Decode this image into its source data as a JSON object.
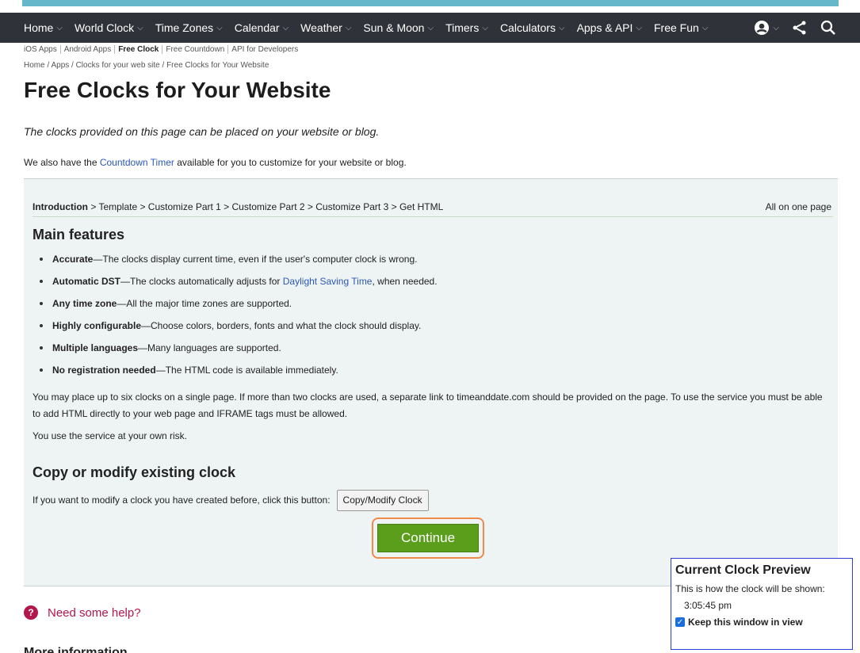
{
  "nav": {
    "items": [
      "Home",
      "World Clock",
      "Time Zones",
      "Calendar",
      "Weather",
      "Sun & Moon",
      "Timers",
      "Calculators",
      "Apps & API",
      "Free Fun"
    ]
  },
  "subnav": {
    "items": [
      "iOS Apps",
      "Android Apps",
      "Free Clock",
      "Free Countdown",
      "API for Developers"
    ],
    "active": "Free Clock"
  },
  "breadcrumb": "Home /  Apps /  Clocks for your web site /  Free Clocks for Your Website",
  "page": {
    "title": "Free Clocks for Your Website",
    "intro": "The clocks provided on this page can be placed on your website or blog.",
    "also_before": "We also have the ",
    "also_link": "Countdown Timer",
    "also_after": " available for you to customize for your website or blog."
  },
  "steps": {
    "current": "Introduction",
    "rest": " > Template > Customize Part 1 > Customize Part 2 > Customize Part 3 > Get HTML",
    "all_on_one": "All on one page"
  },
  "features": {
    "heading": "Main features",
    "items": [
      {
        "title": "Accurate",
        "text": "—The clocks display current time, even if the user's computer clock is wrong."
      },
      {
        "title": "Automatic DST",
        "text": "—The clocks automatically adjusts for ",
        "link": "Daylight Saving Time",
        "after": ", when needed."
      },
      {
        "title": "Any time zone",
        "text": "—All the major time zones are supported."
      },
      {
        "title": "Highly configurable",
        "text": "—Choose colors, borders, fonts and what the clock should display."
      },
      {
        "title": "Multiple languages",
        "text": "—Many languages are supported."
      },
      {
        "title": "No registration needed",
        "text": "—The HTML code is available immediately."
      }
    ]
  },
  "paragraphs": {
    "limits": "You may place up to six clocks on a single page. If more than two clocks are used, a separate link to timeanddate.com should be provided on the page. To use the service you must be able to add HTML directly to your web page and IFRAME tags must be allowed.",
    "risk": "You use the service at your own risk."
  },
  "copy": {
    "heading": "Copy or modify existing clock",
    "text": "If you want to modify a clock you have created before, click this button:",
    "button": "Copy/Modify Clock"
  },
  "continue_label": "Continue",
  "help_label": "Need some help?",
  "cutoff_heading": "More information",
  "preview": {
    "title": "Current Clock Preview",
    "desc": "This is how the clock will be shown:",
    "time": "3:05:45 pm",
    "keep_label": "Keep this window in view",
    "keep_checked": true
  },
  "colors": {
    "nav_bg": "#2f3339",
    "continue_green": "#5a9e1c",
    "highlight_orange": "#f08a4b",
    "preview_border": "#2b3fd6",
    "help_red": "#b2164a"
  }
}
